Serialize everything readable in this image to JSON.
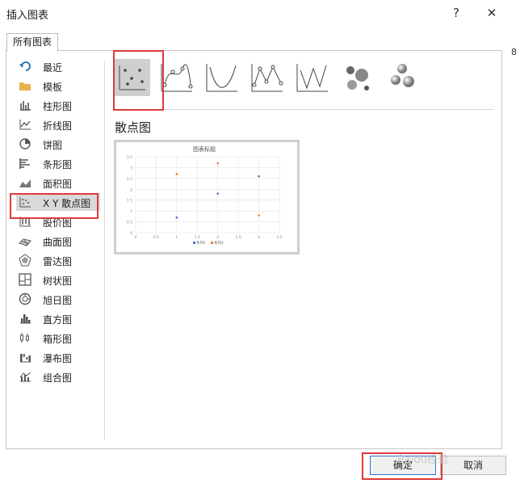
{
  "title": "插入图表",
  "titlebar": {
    "help_label": "?",
    "close_label": "✕"
  },
  "tab_label": "所有图表",
  "sidebar": {
    "items": [
      {
        "label": "最近",
        "icon": "undo-icon"
      },
      {
        "label": "模板",
        "icon": "folder-icon"
      },
      {
        "label": "柱形图",
        "icon": "column-chart-icon"
      },
      {
        "label": "折线图",
        "icon": "line-chart-icon"
      },
      {
        "label": "饼图",
        "icon": "pie-chart-icon"
      },
      {
        "label": "条形图",
        "icon": "bar-chart-icon"
      },
      {
        "label": "面积图",
        "icon": "area-chart-icon"
      },
      {
        "label": "X Y 散点图",
        "icon": "scatter-chart-icon",
        "selected": true
      },
      {
        "label": "股价图",
        "icon": "stock-chart-icon"
      },
      {
        "label": "曲面图",
        "icon": "surface-chart-icon"
      },
      {
        "label": "雷达图",
        "icon": "radar-chart-icon"
      },
      {
        "label": "树状图",
        "icon": "treemap-chart-icon"
      },
      {
        "label": "旭日图",
        "icon": "sunburst-chart-icon"
      },
      {
        "label": "直方图",
        "icon": "histogram-chart-icon"
      },
      {
        "label": "箱形图",
        "icon": "box-chart-icon"
      },
      {
        "label": "瀑布图",
        "icon": "waterfall-chart-icon"
      },
      {
        "label": "组合图",
        "icon": "combo-chart-icon"
      }
    ]
  },
  "subtypes": [
    "scatter-icon",
    "smooth-line-markers-icon",
    "smooth-line-icon",
    "straight-line-markers-icon",
    "straight-line-icon",
    "bubble-icon",
    "3d-bubble-icon"
  ],
  "section_title": "散点图",
  "preview": {
    "chart_data": {
      "type": "scatter",
      "title": "图表标题",
      "xlim": [
        0,
        3.5
      ],
      "ylim": [
        0,
        3.5
      ],
      "x_ticks": [
        "0",
        "0.5",
        "1",
        "1.5",
        "2",
        "2.5",
        "3",
        "3.5"
      ],
      "y_ticks": [
        "0",
        "0.5",
        "1",
        "1.5",
        "2",
        "2.5",
        "3",
        "3.5"
      ],
      "series": [
        {
          "name": "系列1",
          "color": "#4472c4",
          "points": [
            [
              1,
              0.7
            ],
            [
              2,
              1.8
            ],
            [
              3,
              2.6
            ]
          ]
        },
        {
          "name": "系列2",
          "color": "#ed7d31",
          "points": [
            [
              1,
              2.7
            ],
            [
              2,
              3.2
            ],
            [
              3,
              0.8
            ]
          ]
        }
      ],
      "legend": "bottom"
    }
  },
  "buttons": {
    "ok": "确定",
    "cancel": "取消"
  },
  "watermark": "Baidu经验",
  "right_peek_number": "8"
}
